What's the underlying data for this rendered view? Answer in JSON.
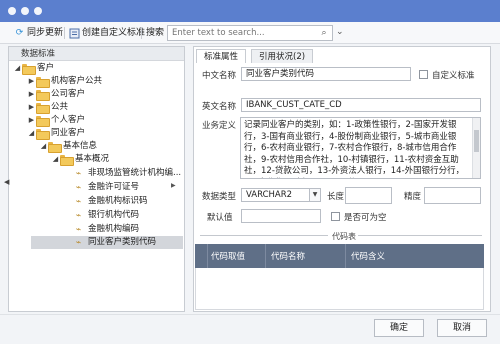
{
  "toolbar": {
    "sync_label": "同步更新",
    "create_label": "创建自定义标准",
    "search_label": "搜索",
    "search_placeholder": "Enter text to search...",
    "search_button_icon": "search-icon",
    "dropdown_icon": "chevron-down-icon"
  },
  "sidebar": {
    "header": "数据标准",
    "items": [
      {
        "label": "客户",
        "kind": "folder",
        "expanded": true
      },
      {
        "label": "机构客户公共",
        "kind": "folder",
        "expanded": false
      },
      {
        "label": "公司客户",
        "kind": "folder",
        "expanded": false
      },
      {
        "label": "公共",
        "kind": "folder",
        "expanded": false
      },
      {
        "label": "个人客户",
        "kind": "folder",
        "expanded": false
      },
      {
        "label": "同业客户",
        "kind": "folder",
        "expanded": true
      },
      {
        "label": "基本信息",
        "kind": "folder",
        "expanded": true
      },
      {
        "label": "基本概况",
        "kind": "folder",
        "expanded": true
      },
      {
        "label": "非现场监管统计机构编...",
        "kind": "leaf"
      },
      {
        "label": "金融许可证号",
        "kind": "leaf"
      },
      {
        "label": "金融机构标识码",
        "kind": "leaf"
      },
      {
        "label": "银行机构代码",
        "kind": "leaf"
      },
      {
        "label": "金融机构编码",
        "kind": "leaf"
      },
      {
        "label": "同业客户类别代码",
        "kind": "leaf",
        "selected": true
      }
    ]
  },
  "tabs": [
    {
      "label": "标准属性",
      "active": true
    },
    {
      "label": "引用状况(2)",
      "active": false
    }
  ],
  "form": {
    "cn_name_label": "中文名称",
    "cn_name_value": "同业客户类别代码",
    "custom_standard_label": "自定义标准",
    "en_name_label": "英文名称",
    "en_name_value": "IBANK_CUST_CATE_CD",
    "biz_def_label": "业务定义",
    "biz_def_value": "记录同业客户的类别，如：1-政策性银行，2-国家开发银行，3-国有商业银行，4-股份制商业银行，5-城市商业银行，6-农村商业银行，7-农村合作银行，8-城市信用合作社，9-农村信用合作社，10-村镇银行，11-农村资金互助社，12-贷款公司，13-外资法人银行，14-外国银行分行，15-企业集团财务公司，16-信",
    "data_type_label": "数据类型",
    "data_type_value": "VARCHAR2",
    "length_label": "长度",
    "length_value": "",
    "precision_label": "精度",
    "precision_value": "",
    "default_label": "默认值",
    "default_value": "",
    "nullable_label": "是否可为空"
  },
  "codes": {
    "section_title": "代码表",
    "columns": [
      "代码取值",
      "代码名称",
      "代码含义"
    ],
    "rows": []
  },
  "footer": {
    "ok_label": "确定",
    "cancel_label": "取消"
  },
  "colors": {
    "titlebar": "#5b7fce",
    "grid_header": "#5f6f87",
    "selected_row": "#d3d6db"
  }
}
